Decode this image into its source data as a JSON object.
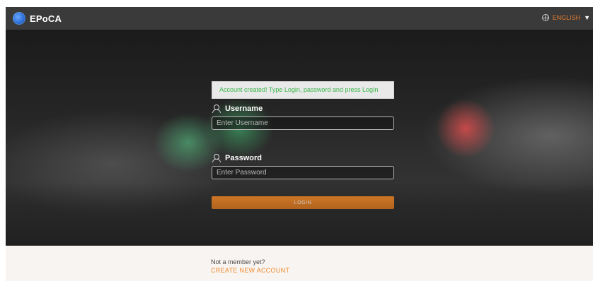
{
  "header": {
    "brand": "EPoCA",
    "language": {
      "selected": "ENGLISH",
      "icon": "globe-icon",
      "caret_icon": "caret-down-icon",
      "color": "#e07a2f"
    }
  },
  "login": {
    "notice": "Account created! Type Login, password and press LogIn",
    "username": {
      "label": "Username",
      "icon": "user-icon",
      "placeholder": "Enter Username",
      "value": ""
    },
    "password": {
      "label": "Password",
      "icon": "user-icon",
      "placeholder": "Enter Password",
      "value": ""
    },
    "button_label": "LOGIN",
    "accent": "#f0882a",
    "notice_color": "#39b54a"
  },
  "footer": {
    "question": "Not a member yet?",
    "create_account": "CREATE NEW ACCOUNT"
  }
}
